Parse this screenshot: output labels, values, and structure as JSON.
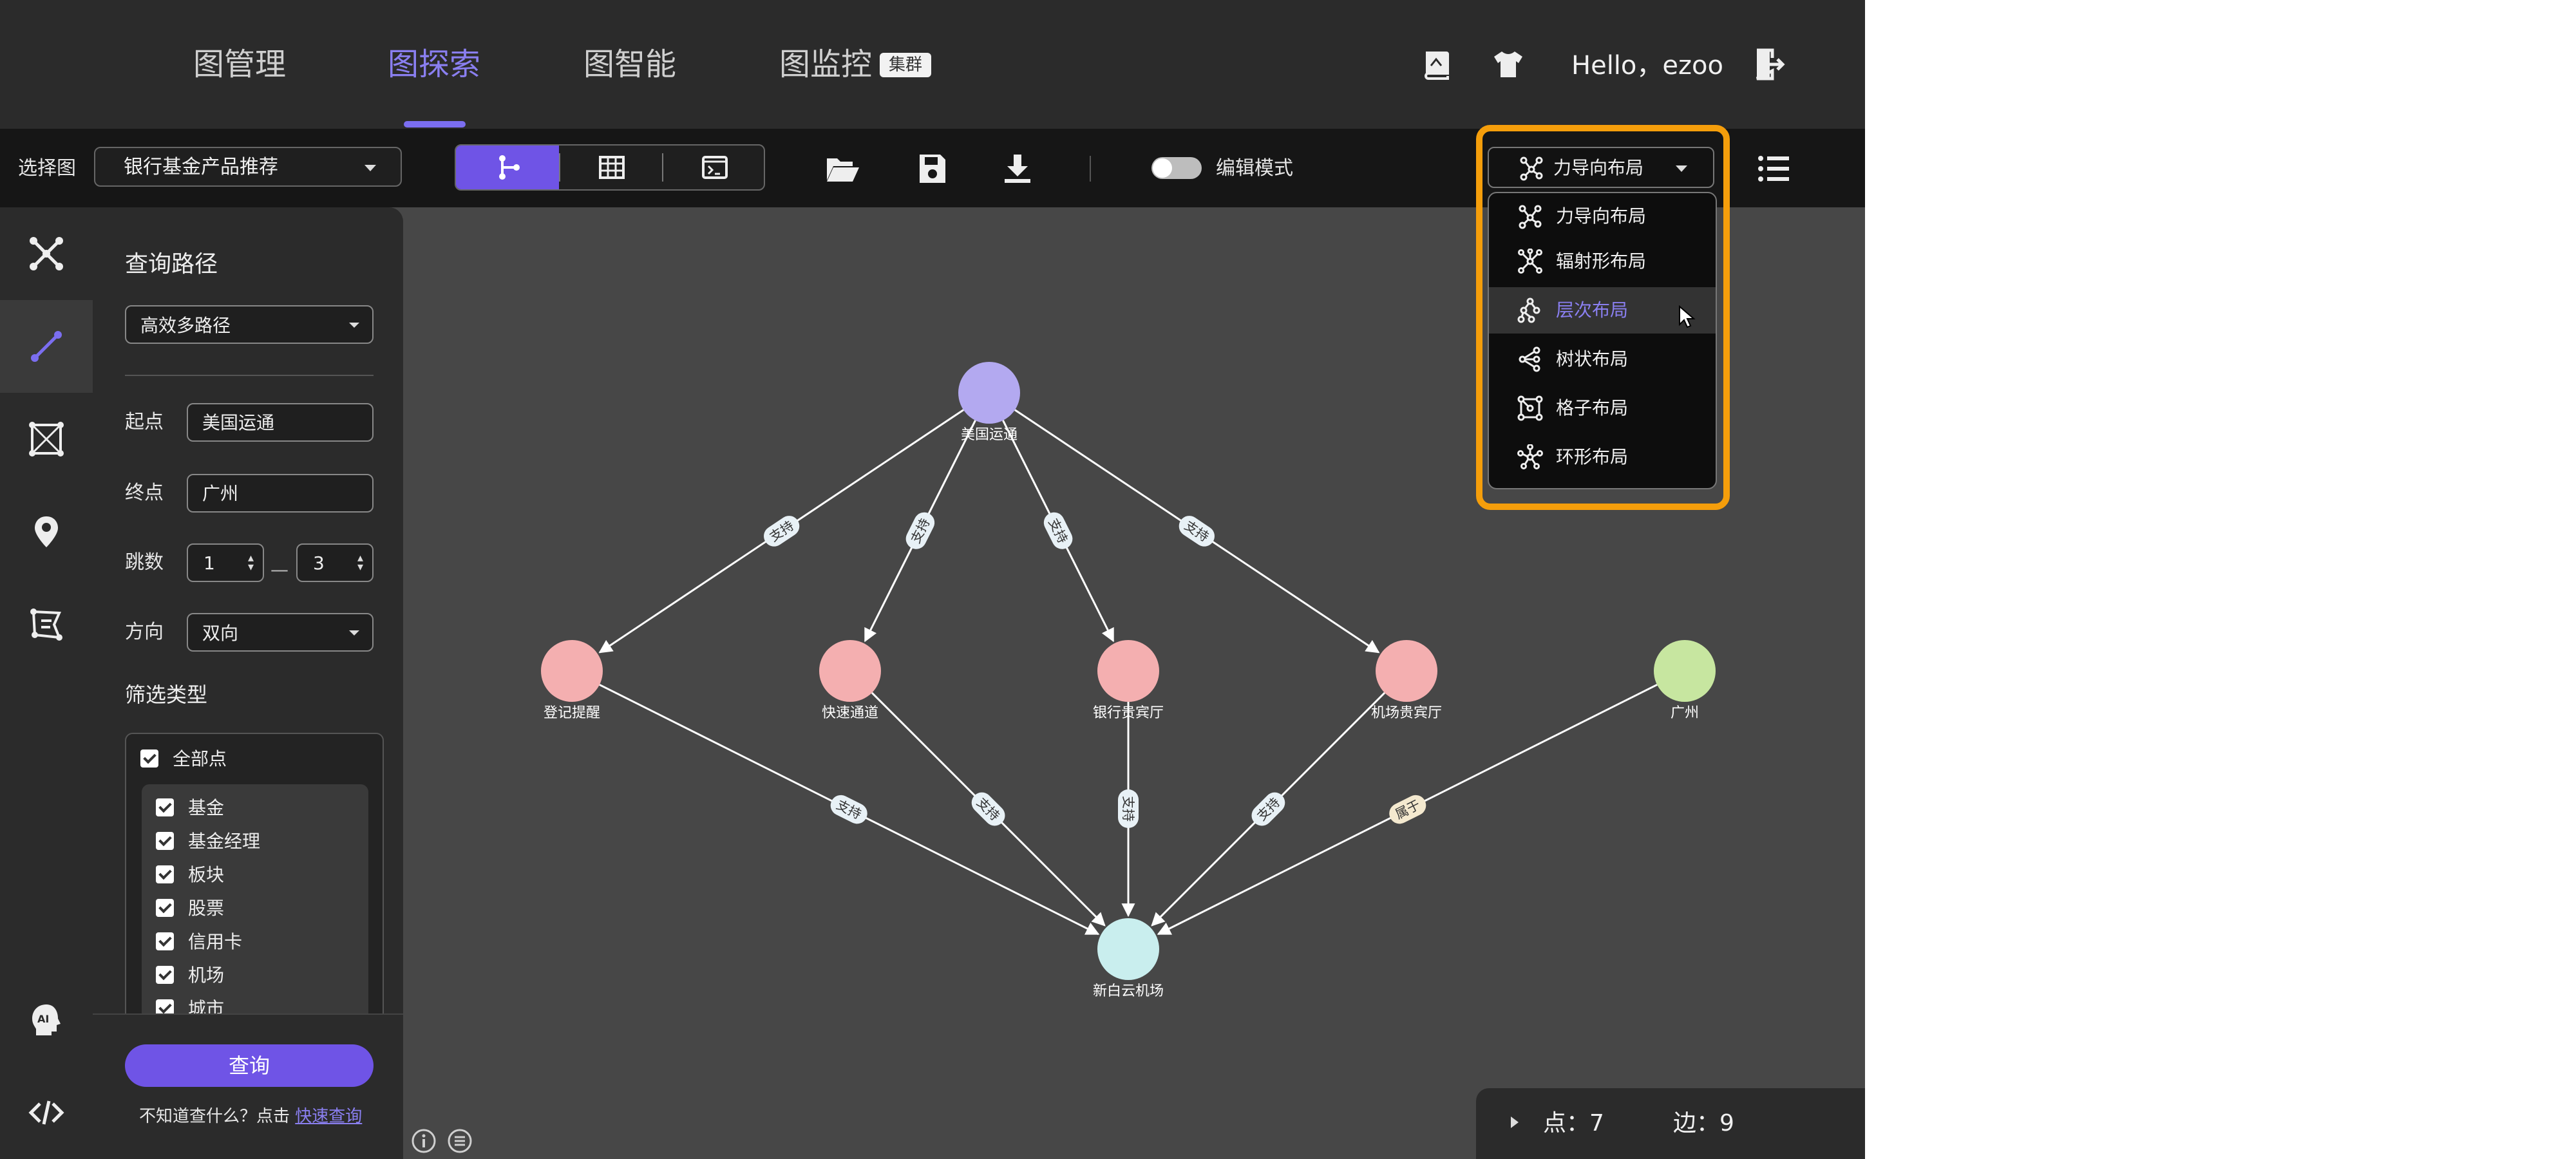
{
  "nav": {
    "tabs": [
      "图管理",
      "图探索",
      "图智能",
      "图监控"
    ],
    "active_tab": "图探索",
    "cluster_badge": "集群",
    "greeting": "Hello，ezoo"
  },
  "toolbar": {
    "select_graph_label": "选择图",
    "selected_graph": "银行基金产品推荐",
    "edit_mode_label": "编辑模式",
    "edit_mode_on": false,
    "layout_selected": "力导向布局"
  },
  "layout_menu": {
    "items": [
      "力导向布局",
      "辐射形布局",
      "层次布局",
      "树状布局",
      "格子布局",
      "环形布局"
    ],
    "hovered": "层次布局"
  },
  "query_panel": {
    "title": "查询路径",
    "path_mode": "高效多路径",
    "start_label": "起点",
    "start_value": "美国运通",
    "end_label": "终点",
    "end_value": "广州",
    "hops_label": "跳数",
    "hops_min": "1",
    "hops_max": "3",
    "hops_separator": "—",
    "direction_label": "方向",
    "direction_value": "双向",
    "filter_label": "筛选类型",
    "all_nodes_label": "全部点",
    "types": [
      "基金",
      "基金经理",
      "板块",
      "股票",
      "信用卡",
      "机场",
      "城市"
    ],
    "query_button": "查询",
    "hint_text": "不知道查什么？点击",
    "hint_link": "快速查询"
  },
  "status": {
    "nodes_text": "点：7",
    "edges_text": "边：9"
  },
  "graph": {
    "nodes": [
      {
        "label": "美国运通",
        "color": "#b3a9f0"
      },
      {
        "label": "登记提醒",
        "color": "#f4afb0"
      },
      {
        "label": "快速通道",
        "color": "#f4afb0"
      },
      {
        "label": "银行贵宾厅",
        "color": "#f4afb0"
      },
      {
        "label": "机场贵宾厅",
        "color": "#f4afb0"
      },
      {
        "label": "广州",
        "color": "#c7e6a0"
      },
      {
        "label": "新白云机场",
        "color": "#c9eeee"
      }
    ],
    "edges": [
      {
        "from": "美国运通",
        "to": "登记提醒",
        "label": "支持"
      },
      {
        "from": "美国运通",
        "to": "快速通道",
        "label": "支持"
      },
      {
        "from": "美国运通",
        "to": "银行贵宾厅",
        "label": "支持"
      },
      {
        "from": "美国运通",
        "to": "机场贵宾厅",
        "label": "支持"
      },
      {
        "from": "登记提醒",
        "to": "新白云机场",
        "label": "支持"
      },
      {
        "from": "快速通道",
        "to": "新白云机场",
        "label": "支持"
      },
      {
        "from": "银行贵宾厅",
        "to": "新白云机场",
        "label": "支持"
      },
      {
        "from": "机场贵宾厅",
        "to": "新白云机场",
        "label": "支持"
      },
      {
        "from": "广州",
        "to": "新白云机场",
        "label": "属于"
      }
    ]
  },
  "colors": {
    "accent": "#6f54e6",
    "accent_text": "#8a7ff0",
    "highlight_border": "#f59e0b",
    "canvas_bg": "#474747",
    "belongs_edge_label_bg": "#f4e9cf"
  }
}
